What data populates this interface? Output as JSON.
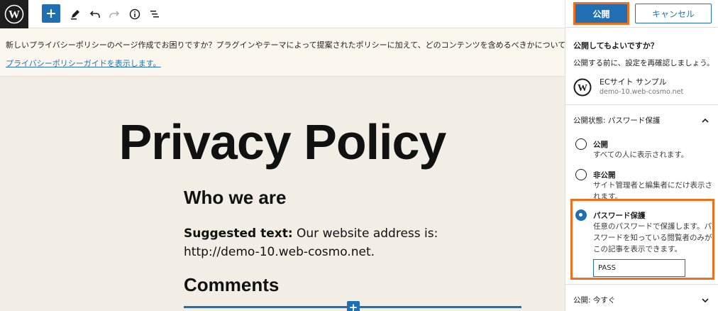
{
  "toolbar": {
    "logo_icon": "wordpress-logo-icon",
    "add_icon": "plus-icon",
    "tools_icon": "pencil-icon",
    "undo_icon": "undo-icon",
    "redo_icon": "redo-icon",
    "info_icon": "info-icon",
    "outline_icon": "list-view-icon"
  },
  "notice": {
    "text": "新しいプライバシーポリシーのページ作成でお困りですか？プラグインやテーマによって提案されたポリシーに加えて、どのコンテンツを含めるべきかについて推奨している",
    "link": "プライバシーポリシーガイドを表示します。"
  },
  "editor": {
    "title": "Privacy Policy",
    "heading_who": "Who we are",
    "para_bold": "Suggested text:",
    "para_text": " Our website address is: http://demo-10.web-cosmo.net.",
    "heading_comments": "Comments",
    "inserter": "+"
  },
  "sidebar": {
    "publish_label": "公開",
    "cancel_label": "キャンセル",
    "title": "公開してもよいですか？",
    "subtitle": "公開する前に、設定を再確認しましょう。",
    "site_name": "ECサイト サンプル",
    "site_url": "demo-10.web-cosmo.net",
    "visibility_heading": "公開状態: パスワード保護",
    "options": [
      {
        "label": "公開",
        "desc": "すべての人に表示されます。",
        "checked": false
      },
      {
        "label": "非公開",
        "desc": "サイト管理者と編集者にだけ表示されます。",
        "checked": false
      },
      {
        "label": "パスワード保護",
        "desc": "任意のパスワードで保護します。パスワードを知っている閲覧者のみがこの記事を表示できます。",
        "checked": true
      }
    ],
    "password_value": "PASS",
    "publish_time": "公開: 今すぐ"
  },
  "colors": {
    "accent": "#1f6fb2",
    "highlight": "#f06f1e"
  }
}
